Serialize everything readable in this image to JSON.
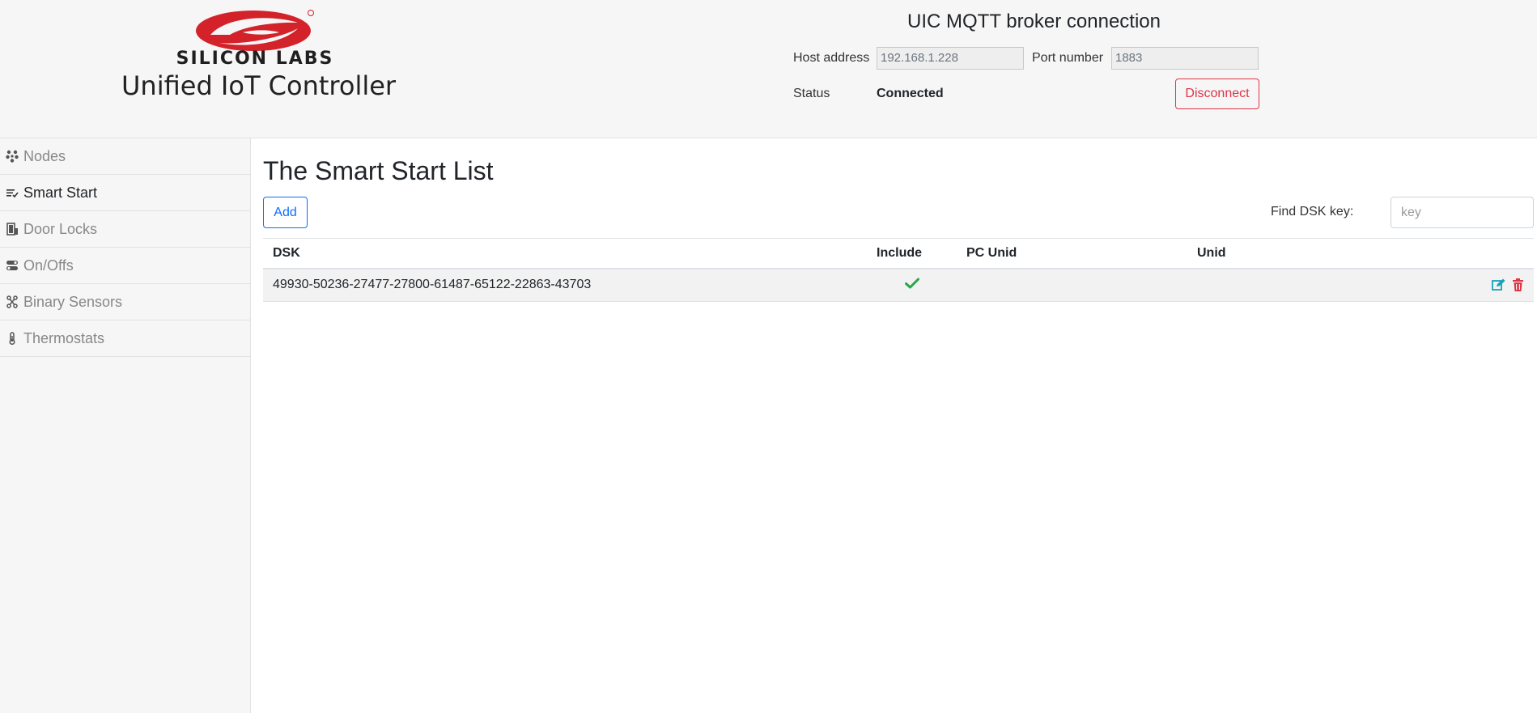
{
  "header": {
    "brand": "SILICON LABS",
    "app_title": "Unified IoT Controller",
    "broker_title": "UIC MQTT broker connection",
    "host_label": "Host address",
    "host_value": "192.168.1.228",
    "port_label": "Port number",
    "port_value": "1883",
    "status_label": "Status",
    "status_value": "Connected",
    "disconnect_label": "Disconnect"
  },
  "sidebar": {
    "items": [
      {
        "label": "Nodes",
        "icon": "nodes-icon"
      },
      {
        "label": "Smart Start",
        "icon": "list-check-icon",
        "active": true
      },
      {
        "label": "Door Locks",
        "icon": "door-icon"
      },
      {
        "label": "On/Offs",
        "icon": "toggle-icon"
      },
      {
        "label": "Binary Sensors",
        "icon": "sensor-icon"
      },
      {
        "label": "Thermostats",
        "icon": "thermometer-icon"
      }
    ]
  },
  "main": {
    "title": "The Smart Start List",
    "add_label": "Add",
    "find_label": "Find DSK key:",
    "find_placeholder": "key",
    "columns": [
      "DSK",
      "Include",
      "PC Unid",
      "Unid"
    ],
    "rows": [
      {
        "dsk": "49930-50236-27477-27800-61487-65122-22863-43703",
        "include": true,
        "pc_unid": "",
        "unid": ""
      }
    ]
  },
  "colors": {
    "brand_red": "#d3222a",
    "primary": "#0d6efd",
    "danger": "#dc3545",
    "success": "#28a745",
    "edit": "#17a2b8"
  }
}
